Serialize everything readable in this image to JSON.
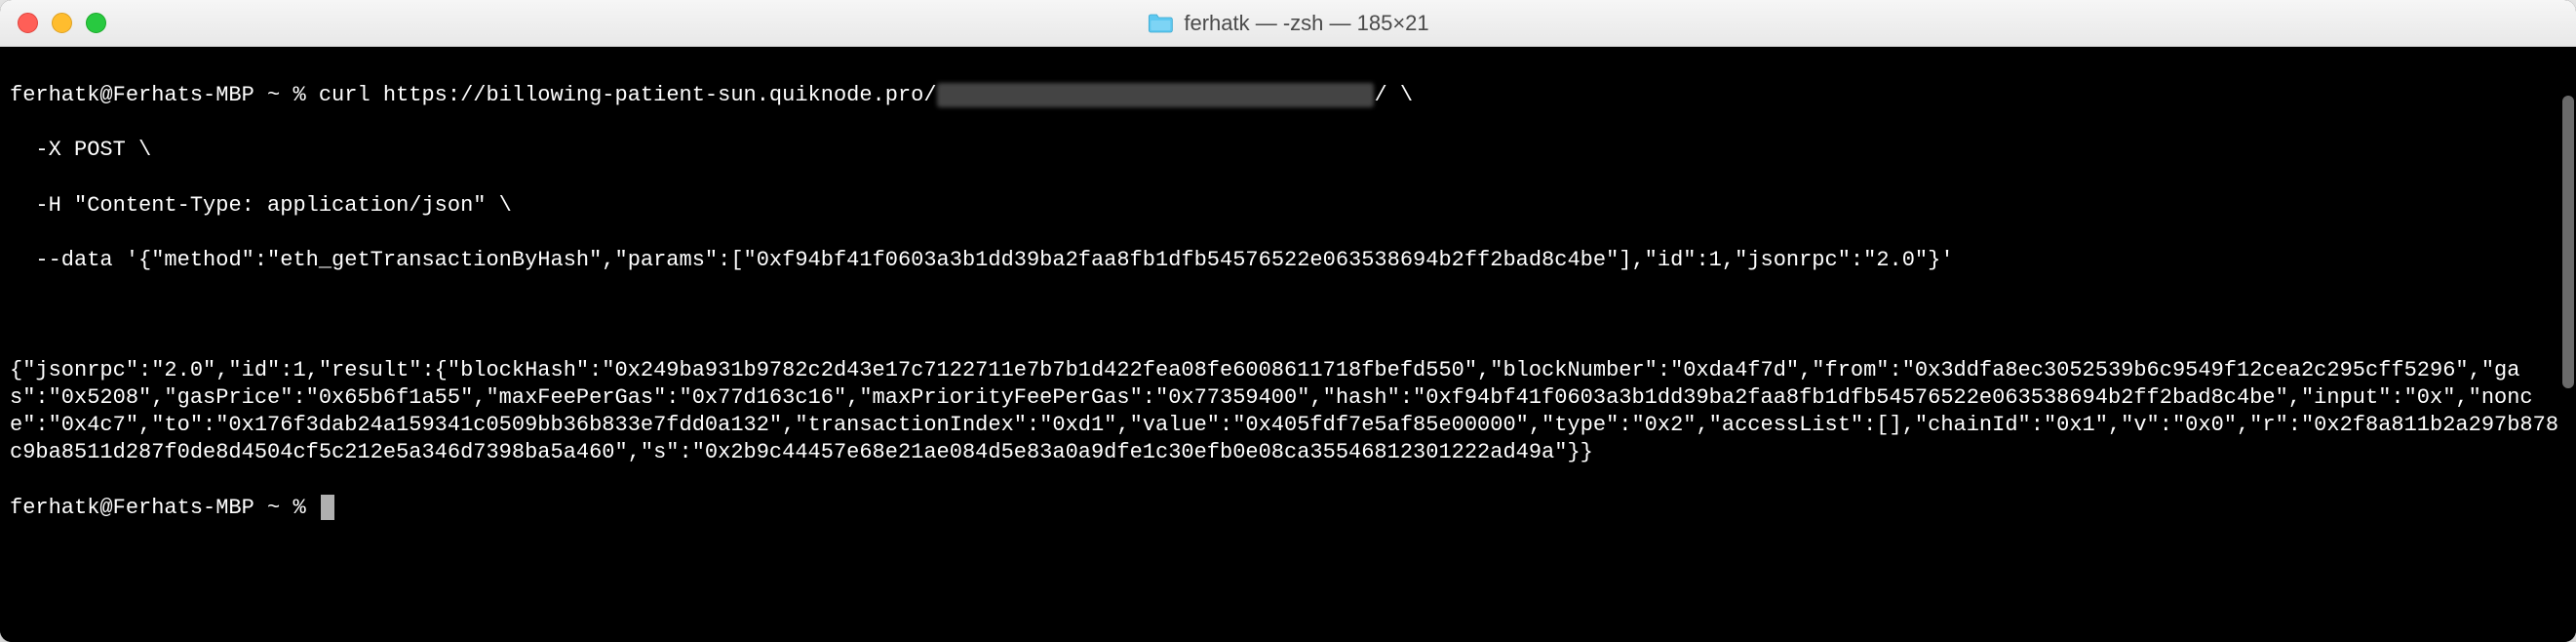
{
  "window": {
    "title": "ferhatk — -zsh — 185×21",
    "folder_icon": "folder-icon"
  },
  "terminal": {
    "prompt1": "ferhatk@Ferhats-MBP ~ % ",
    "cmd_line1": "curl https://billowing-patient-sun.quiknode.pro/",
    "cmd_line1_blur": "                                  ",
    "cmd_line1_tail": "/ \\",
    "cmd_line2": "  -X POST \\",
    "cmd_line3": "  -H \"Content-Type: application/json\" \\",
    "cmd_line4": "  --data '{\"method\":\"eth_getTransactionByHash\",\"params\":[\"0xf94bf41f0603a3b1dd39ba2faa8fb1dfb54576522e063538694b2ff2bad8c4be\"],\"id\":1,\"jsonrpc\":\"2.0\"}'",
    "blank": " ",
    "response": "{\"jsonrpc\":\"2.0\",\"id\":1,\"result\":{\"blockHash\":\"0x249ba931b9782c2d43e17c7122711e7b7b1d422fea08fe6008611718fbefd550\",\"blockNumber\":\"0xda4f7d\",\"from\":\"0x3ddfa8ec3052539b6c9549f12cea2c295cff5296\",\"gas\":\"0x5208\",\"gasPrice\":\"0x65b6f1a55\",\"maxFeePerGas\":\"0x77d163c16\",\"maxPriorityFeePerGas\":\"0x77359400\",\"hash\":\"0xf94bf41f0603a3b1dd39ba2faa8fb1dfb54576522e063538694b2ff2bad8c4be\",\"input\":\"0x\",\"nonce\":\"0x4c7\",\"to\":\"0x176f3dab24a159341c0509bb36b833e7fdd0a132\",\"transactionIndex\":\"0xd1\",\"value\":\"0x405fdf7e5af85e00000\",\"type\":\"0x2\",\"accessList\":[],\"chainId\":\"0x1\",\"v\":\"0x0\",\"r\":\"0x2f8a811b2a297b878c9ba8511d287f0de8d4504cf5c212e5a346d7398ba5a460\",\"s\":\"0x2b9c44457e68e21ae084d5e83a0a9dfe1c30efb0e08ca35546812301222ad49a\"}}",
    "prompt2": "ferhatk@Ferhats-MBP ~ % "
  }
}
